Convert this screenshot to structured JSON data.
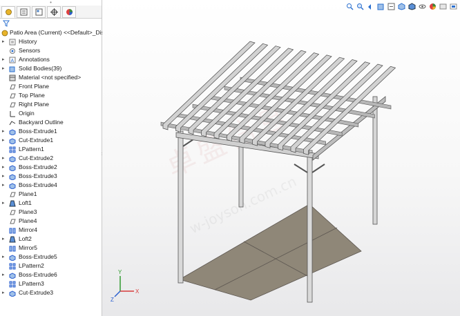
{
  "tree": {
    "root": "Patio Area (Current) <<Default>_Dis",
    "items": [
      {
        "label": "History",
        "icon": "history-icon",
        "expandable": true
      },
      {
        "label": "Sensors",
        "icon": "sensor-icon",
        "expandable": false
      },
      {
        "label": "Annotations",
        "icon": "annotation-icon",
        "expandable": true
      },
      {
        "label": "Solid Bodies(39)",
        "icon": "solid-bodies-icon",
        "expandable": true
      },
      {
        "label": "Material <not specified>",
        "icon": "material-icon",
        "expandable": false
      },
      {
        "label": "Front Plane",
        "icon": "plane-icon",
        "expandable": false
      },
      {
        "label": "Top Plane",
        "icon": "plane-icon",
        "expandable": false
      },
      {
        "label": "Right Plane",
        "icon": "plane-icon",
        "expandable": false
      },
      {
        "label": "Origin",
        "icon": "origin-icon",
        "expandable": false
      },
      {
        "label": "Backyard Outline",
        "icon": "sketch-icon",
        "expandable": false
      },
      {
        "label": "Boss-Extrude1",
        "icon": "extrude-icon",
        "expandable": true
      },
      {
        "label": "Cut-Extrude1",
        "icon": "extrude-icon",
        "expandable": true
      },
      {
        "label": "LPattern1",
        "icon": "pattern-icon",
        "expandable": false
      },
      {
        "label": "Cut-Extrude2",
        "icon": "extrude-icon",
        "expandable": true
      },
      {
        "label": "Boss-Extrude2",
        "icon": "extrude-icon",
        "expandable": true
      },
      {
        "label": "Boss-Extrude3",
        "icon": "extrude-icon",
        "expandable": true
      },
      {
        "label": "Boss-Extrude4",
        "icon": "extrude-icon",
        "expandable": true
      },
      {
        "label": "Plane1",
        "icon": "plane-icon",
        "expandable": false
      },
      {
        "label": "Loft1",
        "icon": "loft-icon",
        "expandable": true
      },
      {
        "label": "Plane3",
        "icon": "plane-icon",
        "expandable": false
      },
      {
        "label": "Plane4",
        "icon": "plane-icon",
        "expandable": false
      },
      {
        "label": "Mirror4",
        "icon": "mirror-icon",
        "expandable": false
      },
      {
        "label": "Loft2",
        "icon": "loft-icon",
        "expandable": true
      },
      {
        "label": "Mirror5",
        "icon": "mirror-icon",
        "expandable": false
      },
      {
        "label": "Boss-Extrude5",
        "icon": "extrude-icon",
        "expandable": true
      },
      {
        "label": "LPattern2",
        "icon": "pattern-icon",
        "expandable": false
      },
      {
        "label": "Boss-Extrude6",
        "icon": "extrude-icon",
        "expandable": true
      },
      {
        "label": "LPattern3",
        "icon": "pattern-icon",
        "expandable": false
      },
      {
        "label": "Cut-Extrude3",
        "icon": "extrude-icon",
        "expandable": true
      }
    ]
  },
  "tabs": [
    "feature-manager-tab",
    "property-manager-tab",
    "configuration-manager-tab",
    "dimxpert-tab",
    "display-manager-tab"
  ],
  "triad": {
    "x": "X",
    "y": "Y",
    "z": "Z"
  },
  "watermark": {
    "text": "卓盛信息",
    "url": "w-joyson.com.cn"
  },
  "colors": {
    "accent": "#2a6fcf",
    "pergola": "#c9c9c9",
    "floor": "#8f8778"
  }
}
